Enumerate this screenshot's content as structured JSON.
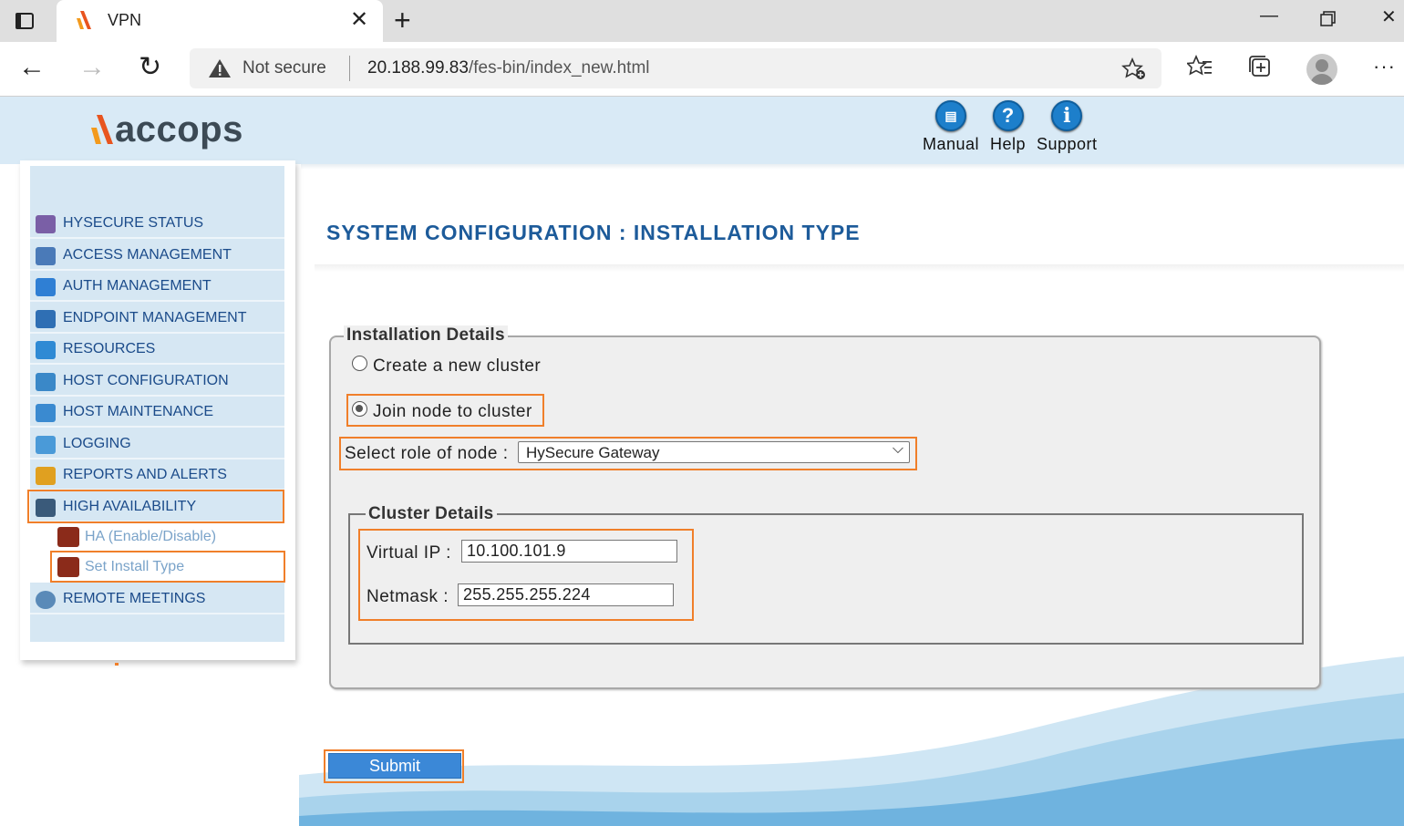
{
  "browser": {
    "tab_title": "VPN",
    "security_label": "Not secure",
    "url_host": "20.188.99.83",
    "url_path": "/fes-bin/index_new.html"
  },
  "header": {
    "brand": "accops",
    "links": [
      {
        "label": "Manual",
        "icon": "manual-icon"
      },
      {
        "label": "Help",
        "icon": "help-icon",
        "glyph": "?"
      },
      {
        "label": "Support",
        "icon": "support-icon",
        "glyph": "i"
      }
    ]
  },
  "sidebar": {
    "items": [
      {
        "label": "HYSECURE STATUS",
        "icon": "status-eye-icon",
        "color": "#7a5fa6"
      },
      {
        "label": "ACCESS MANAGEMENT",
        "icon": "access-icon",
        "color": "#4a7ab8"
      },
      {
        "label": "AUTH MANAGEMENT",
        "icon": "lock-icon",
        "color": "#2f7fd4"
      },
      {
        "label": "ENDPOINT MANAGEMENT",
        "icon": "scales-icon",
        "color": "#2f6fb4"
      },
      {
        "label": "RESOURCES",
        "icon": "resources-icon",
        "color": "#2f8ad4"
      },
      {
        "label": "HOST CONFIGURATION",
        "icon": "gear-icon",
        "color": "#3a88c8"
      },
      {
        "label": "HOST MAINTENANCE",
        "icon": "cart-icon",
        "color": "#3a8ad0"
      },
      {
        "label": "LOGGING",
        "icon": "calendar-icon",
        "color": "#4a9ad8"
      },
      {
        "label": "REPORTS AND ALERTS",
        "icon": "bar-chart-icon",
        "color": "#e0a020"
      },
      {
        "label": "HIGH AVAILABILITY",
        "icon": "cluster-icon",
        "color": "#3a5a7a"
      }
    ],
    "sub_items": [
      {
        "label": "HA (Enable/Disable)",
        "icon": "ha-toggle-icon"
      },
      {
        "label": "Set Install Type",
        "icon": "install-type-icon"
      }
    ],
    "last_item": {
      "label": "REMOTE MEETINGS",
      "icon": "meetings-icon",
      "color": "#5a8ab8"
    }
  },
  "main": {
    "title": "SYSTEM CONFIGURATION : INSTALLATION TYPE",
    "install_details": {
      "legend": "Installation Details",
      "option_create": "Create a new cluster",
      "option_join": "Join node to cluster",
      "selected_option": "join",
      "role_label": "Select role of node :",
      "role_value": "HySecure Gateway"
    },
    "cluster_details": {
      "legend": "Cluster Details",
      "virtual_ip_label": "Virtual IP :",
      "virtual_ip_value": "10.100.101.9",
      "netmask_label": "Netmask :",
      "netmask_value": "255.255.255.224"
    },
    "submit_label": "Submit"
  },
  "colors": {
    "highlight": "#f07f2a",
    "title_blue": "#1d5b9a",
    "menu_bg": "#d6e7f3",
    "submit_blue": "#3b88d7"
  }
}
